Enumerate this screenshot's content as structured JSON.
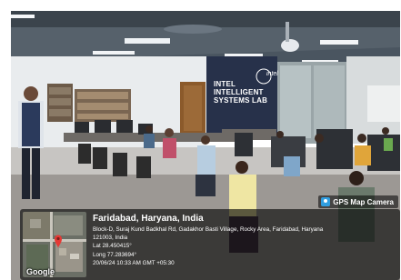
{
  "photo": {
    "wall_sign_lines": [
      "INTEL",
      "INTELLIGENT",
      "SYSTEMS LAB"
    ],
    "brand_logo_text": "intel"
  },
  "gps_stamp": {
    "badge_label": "GPS Map Camera",
    "city": "Faridabad, Haryana, India",
    "address_line": "Block-D, Suraj Kund Badkhal Rd, Gadakhor Basti Village, Rocky Area, Faridabad, Haryana",
    "postal_line": "121003, India",
    "lat": "Lat 28.450415°",
    "long": "Long 77.283694°",
    "datetime": "20/06/24 10:33 AM GMT +05:30",
    "map_provider": "Google"
  },
  "colors": {
    "pin": "#e53935",
    "badge_icon": "#2f9de0",
    "wall_sign_bg": "#1f2a44"
  }
}
